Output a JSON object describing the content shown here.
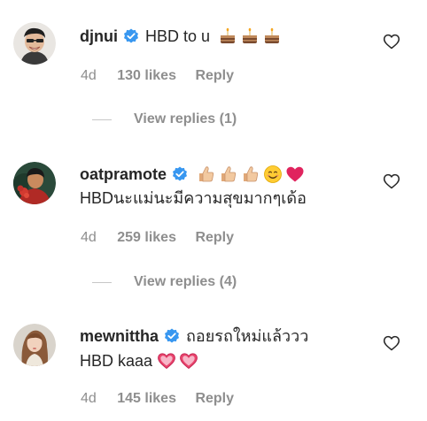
{
  "comments": [
    {
      "username": "djnui",
      "text": "HBD to u",
      "emoji": [
        "cake-emoji",
        "cake-emoji",
        "cake-emoji"
      ],
      "time": "4d",
      "likes": "130 likes",
      "reply": "Reply",
      "view_replies": "View replies (1)"
    },
    {
      "username": "oatpramote",
      "line1_emoji": [
        "thumbs-up-emoji",
        "thumbs-up-emoji",
        "thumbs-up-emoji",
        "smiling-face-emoji",
        "red-heart-emoji"
      ],
      "text": "HBDนะแม่นะมีความสุขมากๆเด้อ",
      "time": "4d",
      "likes": "259 likes",
      "reply": "Reply",
      "view_replies": "View replies (4)"
    },
    {
      "username": "mewnittha",
      "text": "ถอยรถใหม่แล้ววว",
      "text2": "HBD kaaa",
      "text2_emoji": [
        "heart-emoji",
        "heart-emoji"
      ],
      "time": "4d",
      "likes": "145 likes",
      "reply": "Reply"
    }
  ],
  "colors": {
    "primary_text": "#262626",
    "secondary_text": "#8e8e8e",
    "verified_blue": "#3897f0",
    "divider": "#c7c7c7"
  }
}
